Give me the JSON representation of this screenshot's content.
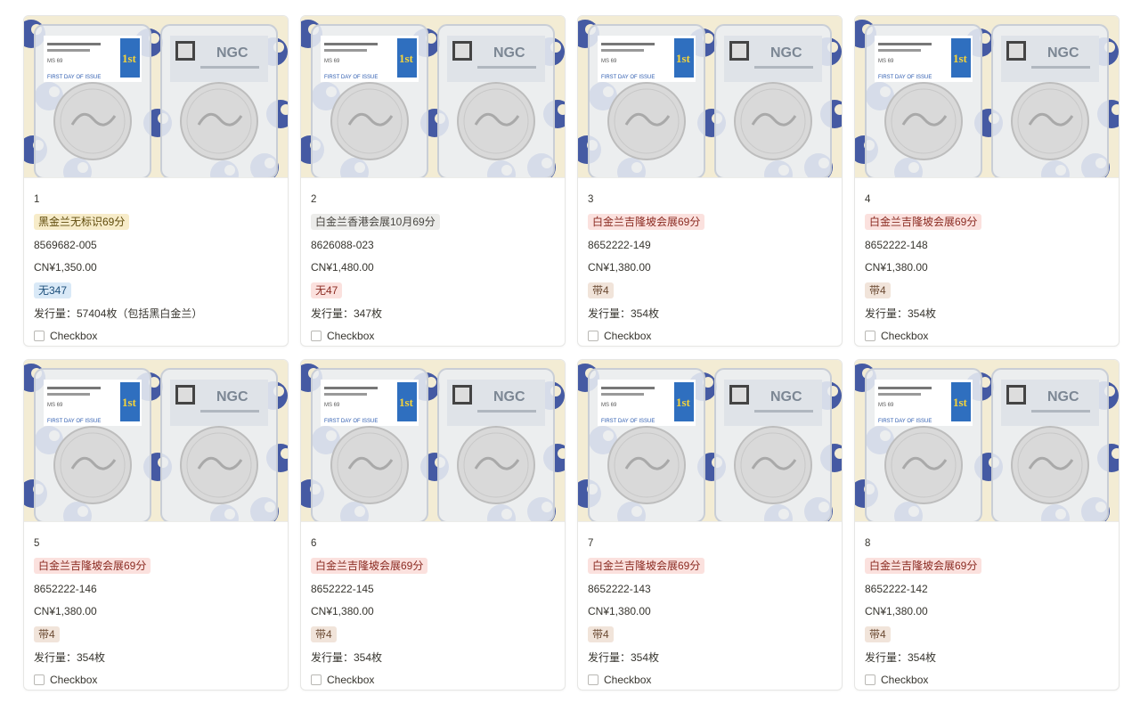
{
  "checkbox_label": "Checkbox",
  "cards": [
    {
      "index": "1",
      "tag": "黑金兰无标识69分",
      "tag_color": "yellow",
      "code": "8569682-005",
      "price": "CN¥1,350.00",
      "badge": "无347",
      "badge_color": "blue",
      "issue": "发行量：57404枚（包括黑白金兰）"
    },
    {
      "index": "2",
      "tag": "白金兰香港会展10月69分",
      "tag_color": "gray",
      "code": "8626088-023",
      "price": "CN¥1,480.00",
      "badge": "无47",
      "badge_color": "red",
      "issue": "发行量：347枚"
    },
    {
      "index": "3",
      "tag": "白金兰吉隆坡会展69分",
      "tag_color": "red",
      "code": "8652222-149",
      "price": "CN¥1,380.00",
      "badge": "带4",
      "badge_color": "brown",
      "issue": "发行量：354枚"
    },
    {
      "index": "4",
      "tag": "白金兰吉隆坡会展69分",
      "tag_color": "red",
      "code": "8652222-148",
      "price": "CN¥1,380.00",
      "badge": "带4",
      "badge_color": "brown",
      "issue": "发行量：354枚"
    },
    {
      "index": "5",
      "tag": "白金兰吉隆坡会展69分",
      "tag_color": "red",
      "code": "8652222-146",
      "price": "CN¥1,380.00",
      "badge": "带4",
      "badge_color": "brown",
      "issue": "发行量：354枚"
    },
    {
      "index": "6",
      "tag": "白金兰吉隆坡会展69分",
      "tag_color": "red",
      "code": "8652222-145",
      "price": "CN¥1,380.00",
      "badge": "带4",
      "badge_color": "brown",
      "issue": "发行量：354枚"
    },
    {
      "index": "7",
      "tag": "白金兰吉隆坡会展69分",
      "tag_color": "red",
      "code": "8652222-143",
      "price": "CN¥1,380.00",
      "badge": "带4",
      "badge_color": "brown",
      "issue": "发行量：354枚"
    },
    {
      "index": "8",
      "tag": "白金兰吉隆坡会展69分",
      "tag_color": "red",
      "code": "8652222-142",
      "price": "CN¥1,380.00",
      "badge": "带4",
      "badge_color": "brown",
      "issue": "发行量：354枚"
    }
  ],
  "thumb_text": {
    "left_slab_mark": "1st",
    "left_slab_caption": "FIRST DAY OF ISSUE",
    "right_slab_brand": "NGC",
    "grade": "MS 69"
  },
  "colors": {
    "pattern_blue": "#26419a",
    "pattern_cream": "#f3ecd4",
    "coin_silver": "#d9d9d9"
  }
}
